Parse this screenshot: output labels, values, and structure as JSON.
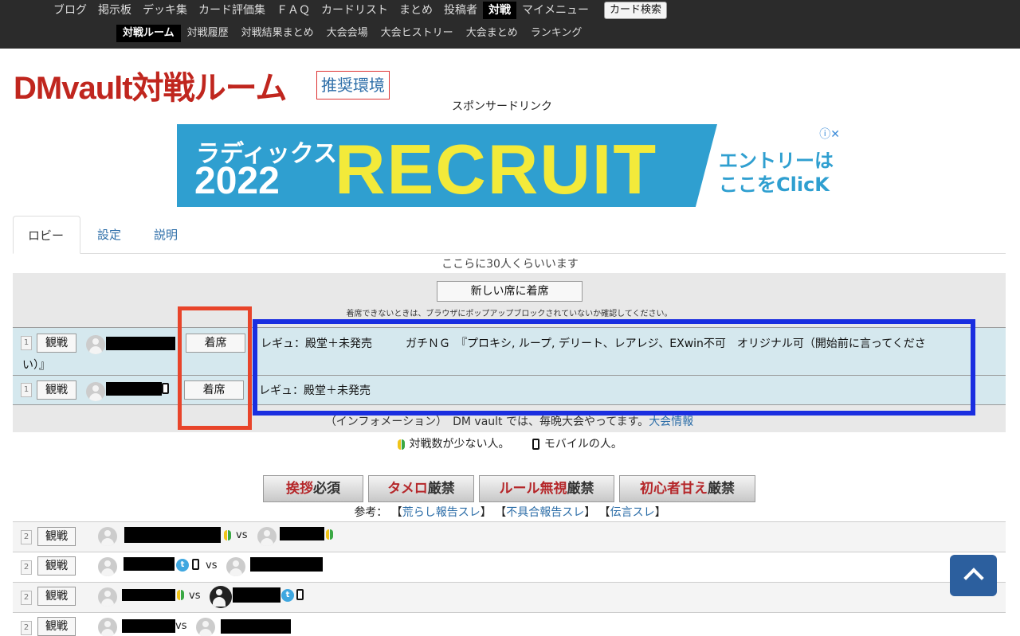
{
  "nav": {
    "primary": [
      "ブログ",
      "掲示板",
      "デッキ集",
      "カード評価集",
      "ＦＡＱ",
      "カードリスト",
      "まとめ",
      "投稿者",
      "対戦",
      "マイメニュー"
    ],
    "active_primary": "対戦",
    "card_search": "カード検索",
    "secondary": [
      "対戦ルーム",
      "対戦履歴",
      "対戦結果まとめ",
      "大会会場",
      "大会ヒストリー",
      "大会まとめ",
      "ランキング"
    ]
  },
  "header": {
    "title": "DMvault対戦ルーム",
    "env_link": "推奨環境",
    "sponsor": "スポンサードリンク"
  },
  "ad": {
    "brand": "ラディックス",
    "year": "2022",
    "headline": "RECRUIT",
    "cta_line1": "エントリーは",
    "cta_line2": "ここをClicK",
    "info": "ⓘ✕"
  },
  "tabs": [
    "ロビー",
    "設定",
    "説明"
  ],
  "lobby": {
    "count_text": "ここらに30人くらいいます",
    "new_seat": "新しい席に着席",
    "note": "着席できないときは、ブラウザにポップアップブロックされていないか確認してください。",
    "seats": [
      {
        "num": "1",
        "watch": "観戦",
        "sit": "着席",
        "rule": "レギュ：殿堂＋未発売　　　ガチＮＧ　『プロキシ, ループ, デリート、レアレジ、EXwin不可　オリジナル可（開始前に言ってくださ",
        "rule_cont": "い）』"
      },
      {
        "num": "1",
        "watch": "観戦",
        "sit": "着席",
        "rule": "レギュ：殿堂＋未発売"
      }
    ],
    "info_text": "（インフォメーション）　DM vault では、毎晩大会やってます。",
    "info_link": "大会情報"
  },
  "legend": {
    "beginner": "対戦数が少ない人。",
    "mobile": "モバイルの人。"
  },
  "rule_banners": [
    {
      "a": "挨拶",
      "b": "必須"
    },
    {
      "a": "タメロ",
      "b": "厳禁"
    },
    {
      "a": "ルール無視",
      "b": "厳禁"
    },
    {
      "a": "初心者甘え",
      "b": "厳禁"
    }
  ],
  "refs": {
    "label": "参考：",
    "links": [
      "荒らし報告スレ",
      "不具合報告スレ",
      "伝言スレ"
    ]
  },
  "matches": [
    {
      "num": "2",
      "watch": "観戦",
      "vs": "vs"
    },
    {
      "num": "2",
      "watch": "観戦",
      "vs": "vs"
    },
    {
      "num": "2",
      "watch": "観戦",
      "vs": "vs"
    },
    {
      "num": "2",
      "watch": "観戦",
      "vs": "vs"
    }
  ],
  "icons": {
    "beginner": "beginner-leaf-icon",
    "mobile": "mobile-phone-icon",
    "twitter": "twitter-icon",
    "back_to_top": "chevron-up-icon"
  },
  "colors": {
    "title": "#c0261e",
    "link": "#2d6ea8",
    "seat_row": "#d5e8ee",
    "highlight_red": "#e8442a",
    "highlight_blue": "#1a2ee0"
  }
}
